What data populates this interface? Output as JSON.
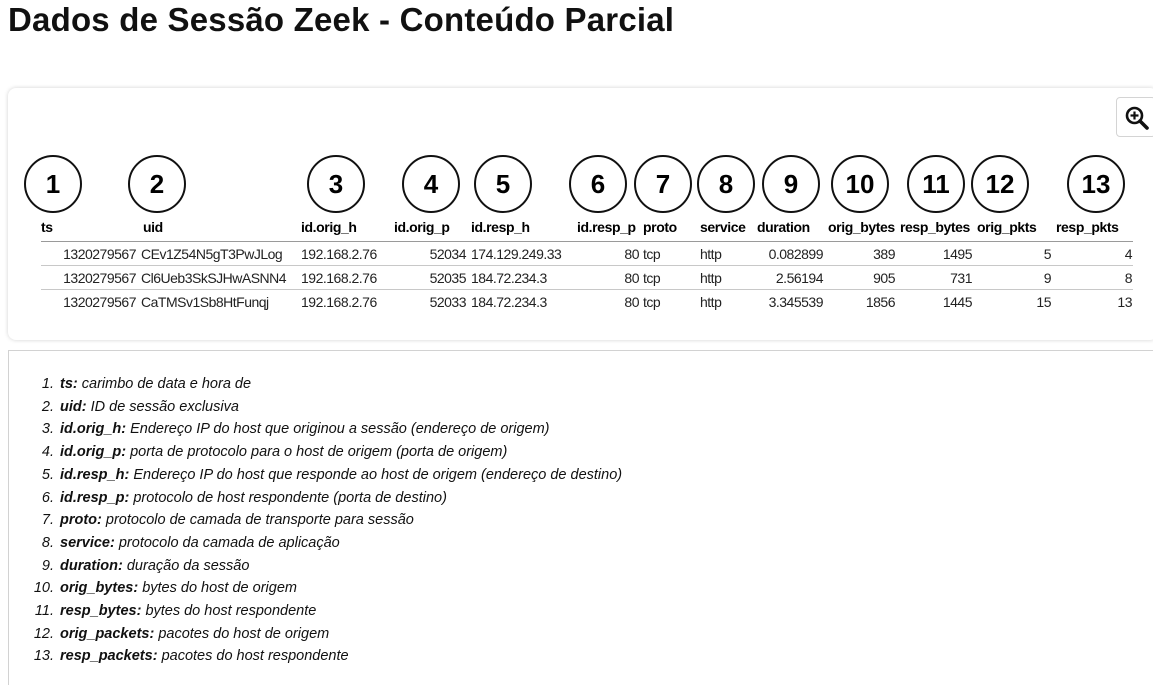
{
  "page_title": "Dados de Sessão Zeek - Conteúdo Parcial",
  "figure": {
    "zoom_icon": "zoom-in-icon",
    "callouts": [
      "1",
      "2",
      "3",
      "4",
      "5",
      "6",
      "7",
      "8",
      "9",
      "10",
      "11",
      "12",
      "13"
    ],
    "columns": [
      "ts",
      "uid",
      "id.orig_h",
      "id.orig_p",
      "id.resp_h",
      "id.resp_p",
      "proto",
      "service",
      "duration",
      "orig_bytes",
      "resp_bytes",
      "orig_pkts",
      "resp_pkts"
    ],
    "rows": [
      [
        "1320279567",
        "CEv1Z54N5gT3PwJLog",
        "192.168.2.76",
        "52034",
        "174.129.249.33",
        "80",
        "tcp",
        "http",
        "0.082899",
        "389",
        "1495",
        "5",
        "4"
      ],
      [
        "1320279567",
        "Cl6Ueb3SkSJHwASNN4",
        "192.168.2.76",
        "52035",
        "184.72.234.3",
        "80",
        "tcp",
        "http",
        "2.56194",
        "905",
        "731",
        "9",
        "8"
      ],
      [
        "1320279567",
        "CaTMSv1Sb8HtFunqj",
        "192.168.2.76",
        "52033",
        "184.72.234.3",
        "80",
        "tcp",
        "http",
        "3.345539",
        "1856",
        "1445",
        "15",
        "13"
      ]
    ]
  },
  "legend": [
    {
      "num": "1.",
      "term": "ts:",
      "desc": "carimbo de data e hora de"
    },
    {
      "num": "2.",
      "term": "uid:",
      "desc": "ID de sessão exclusiva"
    },
    {
      "num": "3.",
      "term": "id.orig_h:",
      "desc": "Endereço IP do host que originou a sessão (endereço de origem)"
    },
    {
      "num": "4.",
      "term": "id.orig_p:",
      "desc": "porta de protocolo para o host de origem (porta de origem)"
    },
    {
      "num": "5.",
      "term": "id.resp_h:",
      "desc": "Endereço IP do host que responde ao host de origem (endereço de destino)"
    },
    {
      "num": "6.",
      "term": "id.resp_p:",
      "desc": "protocolo de host respondente (porta de destino)"
    },
    {
      "num": "7.",
      "term": "proto:",
      "desc": "protocolo de camada de transporte para sessão"
    },
    {
      "num": "8.",
      "term": "service:",
      "desc": "protocolo da camada de aplicação"
    },
    {
      "num": "9.",
      "term": "duration:",
      "desc": "duração da sessão"
    },
    {
      "num": "10.",
      "term": "orig_bytes:",
      "desc": "bytes do host de origem"
    },
    {
      "num": "11.",
      "term": "resp_bytes:",
      "desc": "bytes do host respondente"
    },
    {
      "num": "12.",
      "term": "orig_packets:",
      "desc": "pacotes do host de origem"
    },
    {
      "num": "13.",
      "term": "resp_packets:",
      "desc": "pacotes do host respondente"
    }
  ]
}
